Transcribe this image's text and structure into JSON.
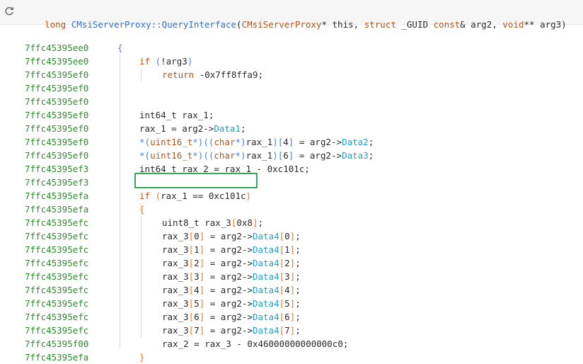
{
  "header": {
    "refresh_icon": "refresh-icon",
    "return_type": "long",
    "function_name": "CMsiServerProxy::QueryInterface",
    "open_paren": "(",
    "p1_type": "CMsiServerProxy",
    "p1_rest": "* this, ",
    "p2_kw": "struct",
    "p2_type": " _GUID ",
    "p2_const": "const",
    "p2_rest": "& arg2, ",
    "p3_type": "void",
    "p3_rest": "** arg3)"
  },
  "colors": {
    "address": "#2e8b2e",
    "keyword": "#b3541e",
    "field": "#21a0c2",
    "function": "#3c6fbf",
    "highlight_border": "#3aa55a"
  },
  "lines": [
    {
      "addr": "7ffc45395ee0",
      "indent": 0,
      "tokens": [
        [
          "br-blue",
          "{"
        ]
      ]
    },
    {
      "addr": "7ffc45395ee0",
      "indent": 1,
      "tokens": [
        [
          "kw",
          "if"
        ],
        [
          "plain",
          " "
        ],
        [
          "br-blue",
          "("
        ],
        [
          "plain",
          "!arg3"
        ],
        [
          "br-blue",
          ")"
        ]
      ]
    },
    {
      "addr": "7ffc45395ef0",
      "indent": 2,
      "tokens": [
        [
          "kw",
          "return"
        ],
        [
          "plain",
          " -0x7ff8ffa9;"
        ]
      ]
    },
    {
      "addr": "7ffc45395ef0",
      "indent": 1,
      "tokens": []
    },
    {
      "addr": "7ffc45395ef0",
      "indent": 1,
      "tokens": []
    },
    {
      "addr": "7ffc45395ef0",
      "indent": 1,
      "tokens": [
        [
          "plain",
          "int64_t rax_1;"
        ]
      ]
    },
    {
      "addr": "7ffc45395ef0",
      "indent": 1,
      "tokens": [
        [
          "plain",
          "rax_1 = arg2->"
        ],
        [
          "field",
          "Data1"
        ],
        [
          "plain",
          ";"
        ]
      ]
    },
    {
      "addr": "7ffc45395ef0",
      "indent": 1,
      "tokens": [
        [
          "br-blue",
          "*("
        ],
        [
          "ty",
          "uint16_t"
        ],
        [
          "br-blue",
          "*)("
        ],
        [
          "br-blue",
          "("
        ],
        [
          "ty",
          "char"
        ],
        [
          "br-blue",
          "*)"
        ],
        [
          "plain",
          "rax_1"
        ],
        [
          "br-blue",
          ")["
        ],
        [
          "plain",
          "4"
        ],
        [
          "br-blue",
          "]"
        ],
        [
          "plain",
          " = arg2->"
        ],
        [
          "field",
          "Data2"
        ],
        [
          "plain",
          ";"
        ]
      ]
    },
    {
      "addr": "7ffc45395ef0",
      "indent": 1,
      "tokens": [
        [
          "br-blue",
          "*("
        ],
        [
          "ty",
          "uint16_t"
        ],
        [
          "br-blue",
          "*)("
        ],
        [
          "br-blue",
          "("
        ],
        [
          "ty",
          "char"
        ],
        [
          "br-blue",
          "*)"
        ],
        [
          "plain",
          "rax_1"
        ],
        [
          "br-blue",
          ")["
        ],
        [
          "plain",
          "6"
        ],
        [
          "br-blue",
          "]"
        ],
        [
          "plain",
          " = arg2->"
        ],
        [
          "field",
          "Data3"
        ],
        [
          "plain",
          ";"
        ]
      ]
    },
    {
      "addr": "7ffc45395ef3",
      "indent": 1,
      "tokens": [
        [
          "plain",
          "int64_t rax_2 = rax_1 - 0xc101c;"
        ]
      ]
    },
    {
      "addr": "7ffc45395ef3",
      "indent": 1,
      "tokens": []
    },
    {
      "addr": "7ffc45395efa",
      "indent": 1,
      "tokens": [
        [
          "kw",
          "if"
        ],
        [
          "plain",
          " "
        ],
        [
          "br-orange",
          "("
        ],
        [
          "plain",
          "rax_1 == 0xc101c"
        ],
        [
          "br-orange",
          ")"
        ]
      ]
    },
    {
      "addr": "7ffc45395efa",
      "indent": 1,
      "tokens": [
        [
          "br-orange",
          "{"
        ]
      ]
    },
    {
      "addr": "7ffc45395efc",
      "indent": 2,
      "tokens": [
        [
          "plain",
          "uint8_t rax_3"
        ],
        [
          "br-orange",
          "["
        ],
        [
          "plain",
          "0x8"
        ],
        [
          "br-orange",
          "]"
        ],
        [
          "plain",
          ";"
        ]
      ]
    },
    {
      "addr": "7ffc45395efc",
      "indent": 2,
      "tokens": [
        [
          "plain",
          "rax_3"
        ],
        [
          "br-orange",
          "["
        ],
        [
          "plain",
          "0"
        ],
        [
          "br-orange",
          "]"
        ],
        [
          "plain",
          " = arg2->"
        ],
        [
          "field",
          "Data4"
        ],
        [
          "br-orange",
          "["
        ],
        [
          "plain",
          "0"
        ],
        [
          "br-orange",
          "]"
        ],
        [
          "plain",
          ";"
        ]
      ]
    },
    {
      "addr": "7ffc45395efc",
      "indent": 2,
      "tokens": [
        [
          "plain",
          "rax_3"
        ],
        [
          "br-orange",
          "["
        ],
        [
          "plain",
          "1"
        ],
        [
          "br-orange",
          "]"
        ],
        [
          "plain",
          " = arg2->"
        ],
        [
          "field",
          "Data4"
        ],
        [
          "br-orange",
          "["
        ],
        [
          "plain",
          "1"
        ],
        [
          "br-orange",
          "]"
        ],
        [
          "plain",
          ";"
        ]
      ]
    },
    {
      "addr": "7ffc45395efc",
      "indent": 2,
      "tokens": [
        [
          "plain",
          "rax_3"
        ],
        [
          "br-orange",
          "["
        ],
        [
          "plain",
          "2"
        ],
        [
          "br-orange",
          "]"
        ],
        [
          "plain",
          " = arg2->"
        ],
        [
          "field",
          "Data4"
        ],
        [
          "br-orange",
          "["
        ],
        [
          "plain",
          "2"
        ],
        [
          "br-orange",
          "]"
        ],
        [
          "plain",
          ";"
        ]
      ]
    },
    {
      "addr": "7ffc45395efc",
      "indent": 2,
      "tokens": [
        [
          "plain",
          "rax_3"
        ],
        [
          "br-orange",
          "["
        ],
        [
          "plain",
          "3"
        ],
        [
          "br-orange",
          "]"
        ],
        [
          "plain",
          " = arg2->"
        ],
        [
          "field",
          "Data4"
        ],
        [
          "br-orange",
          "["
        ],
        [
          "plain",
          "3"
        ],
        [
          "br-orange",
          "]"
        ],
        [
          "plain",
          ";"
        ]
      ]
    },
    {
      "addr": "7ffc45395efc",
      "indent": 2,
      "tokens": [
        [
          "plain",
          "rax_3"
        ],
        [
          "br-orange",
          "["
        ],
        [
          "plain",
          "4"
        ],
        [
          "br-orange",
          "]"
        ],
        [
          "plain",
          " = arg2->"
        ],
        [
          "field",
          "Data4"
        ],
        [
          "br-orange",
          "["
        ],
        [
          "plain",
          "4"
        ],
        [
          "br-orange",
          "]"
        ],
        [
          "plain",
          ";"
        ]
      ]
    },
    {
      "addr": "7ffc45395efc",
      "indent": 2,
      "tokens": [
        [
          "plain",
          "rax_3"
        ],
        [
          "br-orange",
          "["
        ],
        [
          "plain",
          "5"
        ],
        [
          "br-orange",
          "]"
        ],
        [
          "plain",
          " = arg2->"
        ],
        [
          "field",
          "Data4"
        ],
        [
          "br-orange",
          "["
        ],
        [
          "plain",
          "5"
        ],
        [
          "br-orange",
          "]"
        ],
        [
          "plain",
          ";"
        ]
      ]
    },
    {
      "addr": "7ffc45395efc",
      "indent": 2,
      "tokens": [
        [
          "plain",
          "rax_3"
        ],
        [
          "br-orange",
          "["
        ],
        [
          "plain",
          "6"
        ],
        [
          "br-orange",
          "]"
        ],
        [
          "plain",
          " = arg2->"
        ],
        [
          "field",
          "Data4"
        ],
        [
          "br-orange",
          "["
        ],
        [
          "plain",
          "6"
        ],
        [
          "br-orange",
          "]"
        ],
        [
          "plain",
          ";"
        ]
      ]
    },
    {
      "addr": "7ffc45395efc",
      "indent": 2,
      "tokens": [
        [
          "plain",
          "rax_3"
        ],
        [
          "br-orange",
          "["
        ],
        [
          "plain",
          "7"
        ],
        [
          "br-orange",
          "]"
        ],
        [
          "plain",
          " = arg2->"
        ],
        [
          "field",
          "Data4"
        ],
        [
          "br-orange",
          "["
        ],
        [
          "plain",
          "7"
        ],
        [
          "br-orange",
          "]"
        ],
        [
          "plain",
          ";"
        ]
      ]
    },
    {
      "addr": "7ffc45395f00",
      "indent": 2,
      "tokens": [
        [
          "plain",
          "rax_2 = rax_3 - 0x46000000000000c0;"
        ]
      ]
    },
    {
      "addr": "7ffc45395efa",
      "indent": 1,
      "tokens": [
        [
          "br-orange",
          "}"
        ]
      ]
    }
  ]
}
